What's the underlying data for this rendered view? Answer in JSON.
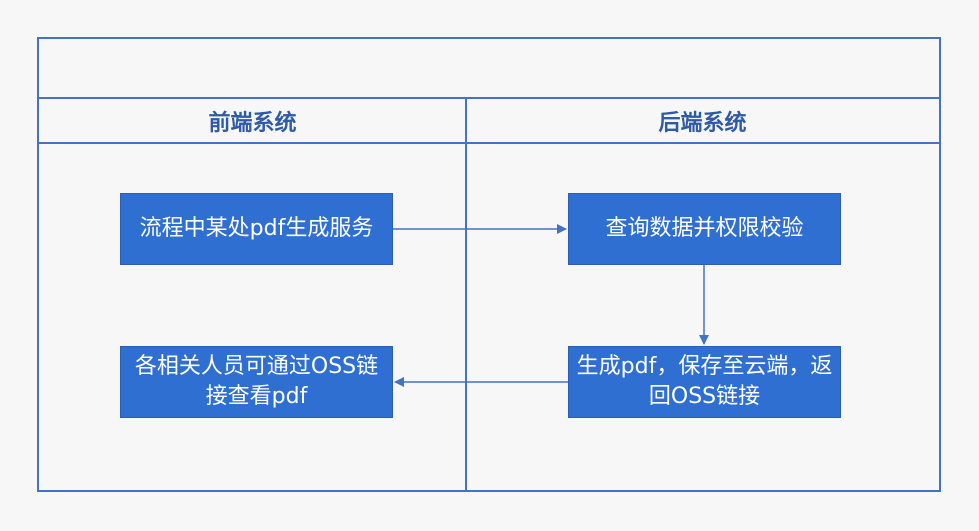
{
  "lanes": {
    "left_title": "前端系统",
    "right_title": "后端系统"
  },
  "nodes": {
    "n1": "流程中某处pdf生成服务",
    "n2": "查询数据并权限校验",
    "n3": "生成pdf，保存至云端，返回OSS链接",
    "n4": "各相关人员可通过OSS链接查看pdf"
  },
  "colors": {
    "border": "#4472c4",
    "node_fill": "#2e6fd1",
    "header_text": "#2e5aa8",
    "background": "#f7f7f7"
  }
}
